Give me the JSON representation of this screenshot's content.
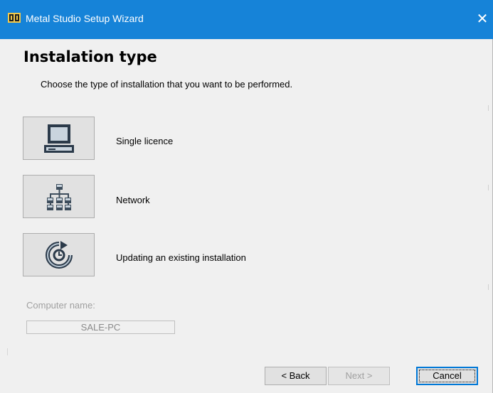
{
  "window": {
    "title": "Metal Studio Setup Wizard",
    "close_glyph": "✕",
    "app_icon": "metal-studio-app-icon",
    "colors": {
      "titlebar": "#1683d8",
      "background": "#f0f0f0",
      "button_face": "#e1e1e1",
      "default_border": "#0078d7",
      "disabled_text": "#a0a0a0"
    }
  },
  "page": {
    "title": "Instalation type",
    "subtitle": "Choose the type of installation that you want to be performed."
  },
  "options": [
    {
      "label": "Single licence",
      "icon": "computer-icon"
    },
    {
      "label": "Network",
      "icon": "network-icon"
    },
    {
      "label": "Updating an existing installation",
      "icon": "update-icon"
    }
  ],
  "computer": {
    "label": "Computer name:",
    "value": "SALE-PC"
  },
  "buttons": {
    "back": "< Back",
    "next": "Next >",
    "cancel": "Cancel"
  }
}
